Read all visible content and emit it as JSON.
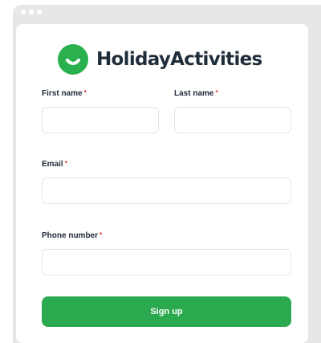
{
  "window": {
    "controls": [
      "dot",
      "dot",
      "dot"
    ]
  },
  "brand": {
    "name": "HolidayActivities",
    "icon": "smile-logo-icon",
    "color": "#2bb04f"
  },
  "form": {
    "first_name": {
      "label": "First name",
      "required_mark": "*",
      "value": "",
      "placeholder": ""
    },
    "last_name": {
      "label": "Last name",
      "required_mark": "*",
      "value": "",
      "placeholder": ""
    },
    "email": {
      "label": "Email",
      "required_mark": "*",
      "value": "",
      "placeholder": ""
    },
    "phone": {
      "label": "Phone number",
      "required_mark": "*",
      "value": "",
      "placeholder": ""
    },
    "submit_label": "Sign up",
    "submit_color": "#2aa94f"
  }
}
